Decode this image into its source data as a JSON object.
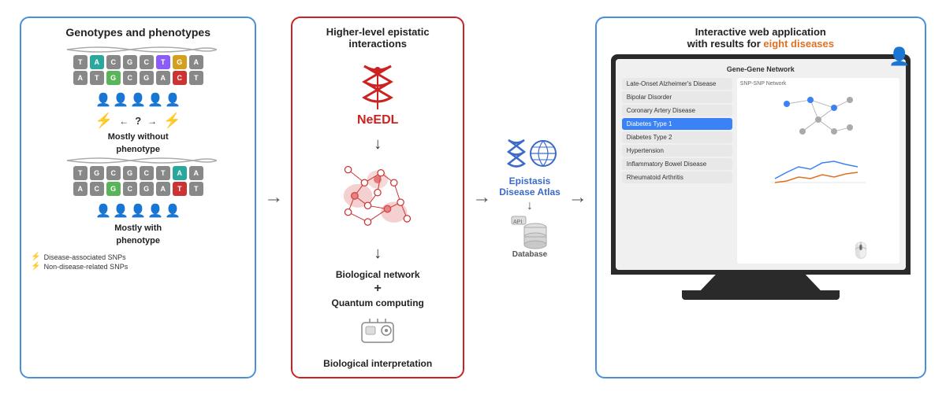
{
  "panel_left": {
    "title": "Genotypes and phenotypes",
    "dna_top": [
      [
        {
          "letter": "T",
          "color": "gray"
        },
        {
          "letter": "A",
          "color": "teal"
        },
        {
          "letter": "C",
          "color": "gray"
        },
        {
          "letter": "G",
          "color": "gray"
        },
        {
          "letter": "C",
          "color": "gray"
        },
        {
          "letter": "T",
          "color": "purple"
        },
        {
          "letter": "G",
          "color": "yellow"
        },
        {
          "letter": "A",
          "color": "gray"
        }
      ],
      [
        {
          "letter": "A",
          "color": "gray"
        },
        {
          "letter": "T",
          "color": "gray"
        },
        {
          "letter": "G",
          "color": "green"
        },
        {
          "letter": "C",
          "color": "gray"
        },
        {
          "letter": "G",
          "color": "gray"
        },
        {
          "letter": "A",
          "color": "gray"
        },
        {
          "letter": "C",
          "color": "red"
        },
        {
          "letter": "T",
          "color": "gray"
        }
      ]
    ],
    "label_no_phenotype": "Mostly without",
    "label_no_phenotype2": "phenotype",
    "dna_bottom": [
      [
        {
          "letter": "T",
          "color": "gray"
        },
        {
          "letter": "G",
          "color": "gray"
        },
        {
          "letter": "C",
          "color": "gray"
        },
        {
          "letter": "G",
          "color": "gray"
        },
        {
          "letter": "C",
          "color": "gray"
        },
        {
          "letter": "T",
          "color": "gray"
        },
        {
          "letter": "A",
          "color": "teal"
        },
        {
          "letter": "A",
          "color": "gray"
        }
      ],
      [
        {
          "letter": "A",
          "color": "gray"
        },
        {
          "letter": "C",
          "color": "gray"
        },
        {
          "letter": "G",
          "color": "green"
        },
        {
          "letter": "C",
          "color": "gray"
        },
        {
          "letter": "G",
          "color": "gray"
        },
        {
          "letter": "A",
          "color": "gray"
        },
        {
          "letter": "T",
          "color": "red"
        },
        {
          "letter": "T",
          "color": "gray"
        }
      ]
    ],
    "label_with_phenotype": "Mostly with",
    "label_with_phenotype2": "phenotype",
    "legend": [
      {
        "symbol": "⚡",
        "color": "#d4a020",
        "text": "Disease-associated SNPs"
      },
      {
        "symbol": "⚡",
        "color": "#3b82f6",
        "text": "Non-disease-related SNPs"
      }
    ]
  },
  "panel_middle": {
    "title_line1": "Higher-level epistatic",
    "title_line2": "interactions",
    "needl_label": "NeEDL",
    "arrow_label": "→",
    "bio_network": "Biological",
    "bio_network2": "network",
    "plus": "+",
    "quantum": "Quantum",
    "quantum2": "computing",
    "bio_interp": "Biological",
    "bio_interp2": "interpretation"
  },
  "arrow_labels": {
    "right1": "→",
    "right2": "→"
  },
  "epistasis": {
    "title": "Epistasis",
    "title2": "Disease Atlas",
    "database_label": "Database"
  },
  "webapp": {
    "title_line1": "Interactive web application",
    "title_line2": "with results for ",
    "eight": "eight diseases",
    "diseases": [
      {
        "name": "Late-Onset Alzheimer's Disease",
        "selected": false
      },
      {
        "name": "Bipolar Disorder",
        "selected": false
      },
      {
        "name": "Coronary Artery Disease",
        "selected": false
      },
      {
        "name": "Diabetes Type 1",
        "selected": true
      },
      {
        "name": "Diabetes Type 2",
        "selected": false
      },
      {
        "name": "Hypertension",
        "selected": false
      },
      {
        "name": "Inflammatory Bowel Disease",
        "selected": false
      },
      {
        "name": "Rheumatoid Arthritis",
        "selected": false
      }
    ]
  }
}
